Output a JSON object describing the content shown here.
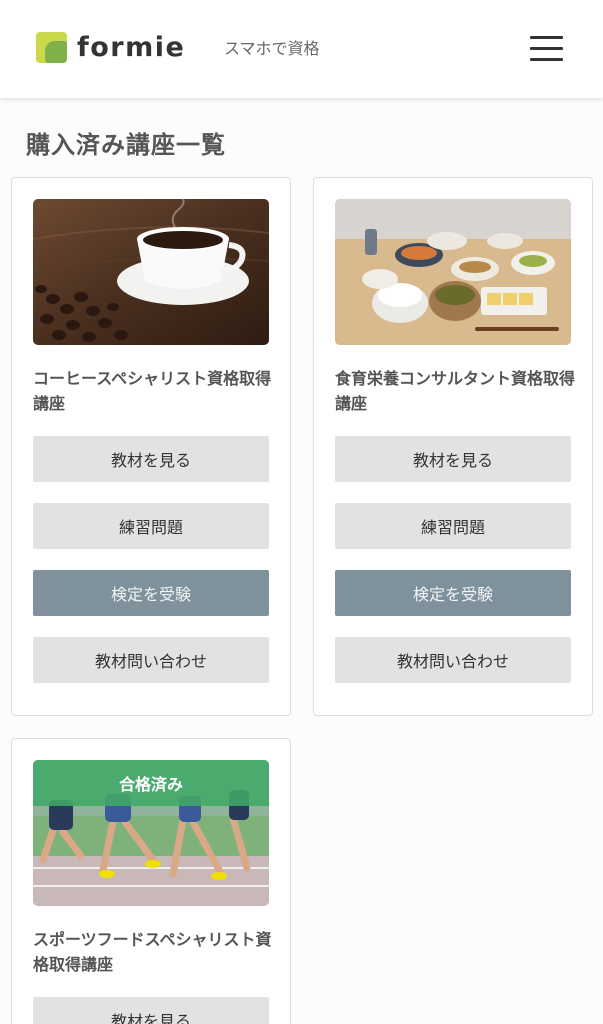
{
  "header": {
    "logo_text": "formie",
    "tagline": "スマホで資格",
    "menu_icon": "hamburger-menu-icon",
    "colors": {
      "logo_light": "#c9d94a",
      "logo_dark": "#7fb04a"
    }
  },
  "page": {
    "title": "購入済み講座一覧"
  },
  "courses": [
    {
      "title": "コーヒースペシャリスト資格取得講座",
      "image": "coffee-cup-and-beans-photo",
      "buttons": [
        "教材を見る",
        "練習問題",
        "検定を受験",
        "教材問い合わせ"
      ]
    },
    {
      "title": "食育栄養コンサルタント資格取得講座",
      "image": "japanese-meal-table-photo",
      "buttons": [
        "教材を見る",
        "練習問題",
        "検定を受験",
        "教材問い合わせ"
      ]
    },
    {
      "title": "スポーツフードスペシャリスト資格取得講座",
      "image": "runners-on-track-photo",
      "badge": "合格済み",
      "buttons": [
        "教材を見る"
      ]
    }
  ],
  "colors": {
    "exam_button": "#7f919b",
    "default_button": "#e2e2e2",
    "passed_badge": "#42a868"
  }
}
